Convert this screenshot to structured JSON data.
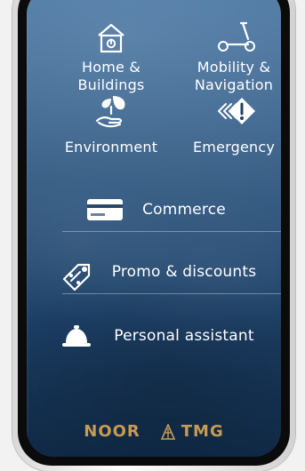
{
  "tiles": {
    "home": {
      "label": "Home &\nBuildings",
      "icon": "home-building-icon"
    },
    "mobility": {
      "label": "Mobility &\nNavigation",
      "icon": "scooter-icon"
    },
    "environment": {
      "label": "Environment",
      "icon": "plant-hand-icon"
    },
    "emergency": {
      "label": "Emergency",
      "icon": "warning-diamond-icon"
    }
  },
  "commerce": {
    "label": "Commerce",
    "icon": "card-icon"
  },
  "promo": {
    "label": "Promo & discounts",
    "icon": "tag-icon"
  },
  "assistant": {
    "label": "Personal assistant",
    "icon": "service-bell-icon"
  },
  "branding": {
    "left": "NOOR",
    "right": "TMG",
    "color": "#c89a52"
  },
  "colors": {
    "screen_top": "#3d6a97",
    "screen_bottom": "#102a47",
    "divider": "rgba(255,255,255,0.35)"
  }
}
